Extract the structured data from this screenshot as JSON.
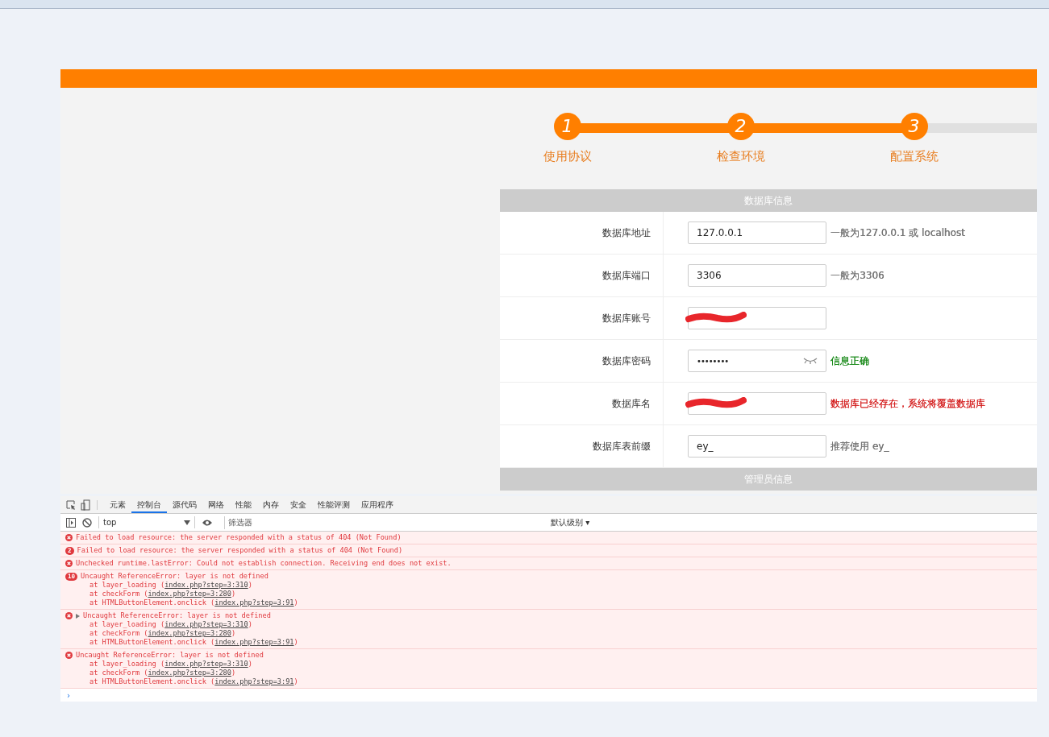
{
  "header_bar": {
    "color": "#ff7f00"
  },
  "steps": [
    {
      "number": "1",
      "label": "使用协议",
      "done": true
    },
    {
      "number": "2",
      "label": "检查环境",
      "done": true
    },
    {
      "number": "3",
      "label": "配置系统",
      "done": true
    }
  ],
  "sections": [
    {
      "title": "数据库信息",
      "fields": [
        {
          "label": "数据库地址",
          "value": "127.0.0.1",
          "kind": "text",
          "hint": "一般为127.0.0.1 或 localhost",
          "color": "#777777"
        },
        {
          "label": "数据库端口",
          "value": "3306",
          "kind": "text",
          "hint": "一般为3306",
          "color": "#777777"
        },
        {
          "label": "数据库账号",
          "kind": "redacted"
        },
        {
          "label": "数据库密码",
          "value": "••••••••",
          "kind": "password",
          "hint": "信息正确",
          "color": "#1a8a1a"
        },
        {
          "label": "数据库名",
          "kind": "redacted",
          "hint": "数据库已经存在，系统将覆盖数据库",
          "color": "#d42020"
        },
        {
          "label": "数据库表前缀",
          "value": "ey_",
          "kind": "text",
          "hint": "推荐使用 ey_",
          "color": "#777777"
        }
      ]
    },
    {
      "title": "管理员信息"
    }
  ],
  "devtools": {
    "tabs": [
      {
        "label": "元素",
        "selected": false
      },
      {
        "label": "控制台",
        "selected": true
      },
      {
        "label": "源代码",
        "selected": false
      },
      {
        "label": "网络",
        "selected": false
      },
      {
        "label": "性能",
        "selected": false
      },
      {
        "label": "内存",
        "selected": false
      },
      {
        "label": "安全",
        "selected": false
      },
      {
        "label": "性能评测",
        "selected": false
      },
      {
        "label": "应用程序",
        "selected": false
      }
    ],
    "context": "top",
    "filter_placeholder": "筛选器",
    "levels": "默认级别 ▾",
    "messages": [
      {
        "text": "Failed to load resource: the server responded with a status of 404 (Not Found)"
      },
      {
        "count": "2",
        "text": "Failed to load resource: the server responded with a status of 404 (Not Found)"
      },
      {
        "text": "Unchecked runtime.lastError: Could not establish connection. Receiving end does not exist."
      },
      {
        "count": "10",
        "text": "Uncaught ReferenceError: layer is not defined",
        "stack": [
          {
            "text": "at layer_loading (",
            "link": "index.php?step=3:310",
            "end": ")"
          },
          {
            "text": "at checkForm (",
            "link": "index.php?step=3:280",
            "end": ")"
          },
          {
            "text": "at HTMLButtonElement.onclick (",
            "link": "index.php?step=3:91",
            "end": ")"
          }
        ]
      },
      {
        "expandable": true,
        "text": "Uncaught ReferenceError: layer is not defined",
        "stack": [
          {
            "text": "at layer_loading (",
            "link": "index.php?step=3:310",
            "end": ")"
          },
          {
            "text": "at checkForm (",
            "link": "index.php?step=3:280",
            "end": ")"
          },
          {
            "text": "at HTMLButtonElement.onclick (",
            "link": "index.php?step=3:91",
            "end": ")"
          }
        ]
      },
      {
        "text": "Uncaught ReferenceError: layer is not defined",
        "stack": [
          {
            "text": "at layer_loading (",
            "link": "index.php?step=3:310",
            "end": ")"
          },
          {
            "text": "at checkForm (",
            "link": "index.php?step=3:280",
            "end": ")"
          },
          {
            "text": "at HTMLButtonElement.onclick (",
            "link": "index.php?step=3:91",
            "end": ")"
          }
        ]
      }
    ],
    "prompt": "›"
  }
}
